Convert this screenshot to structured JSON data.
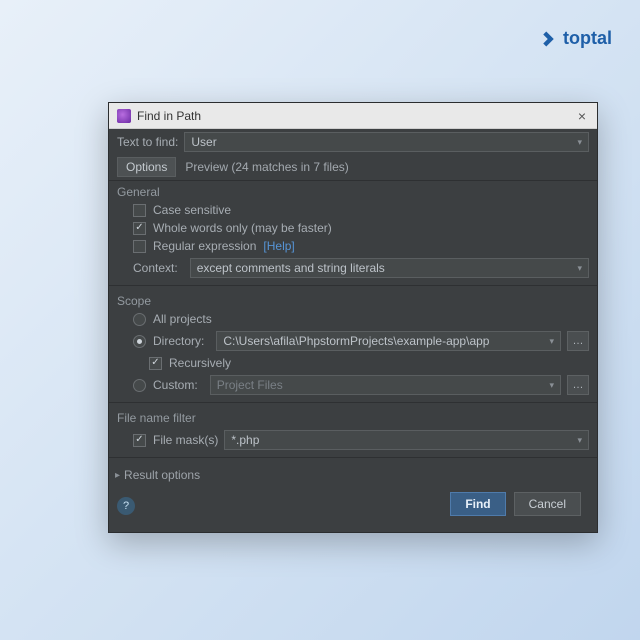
{
  "brand": {
    "name": "toptal"
  },
  "dialog": {
    "title": "Find in Path",
    "text_to_find_label": "Text to find:",
    "text_to_find_value": "User",
    "tabs": {
      "options": "Options",
      "preview": "Preview (24 matches in 7 files)"
    },
    "general": {
      "title": "General",
      "case_sensitive": "Case sensitive",
      "whole_words": "Whole words only (may be faster)",
      "regex": "Regular expression",
      "regex_help": "[Help]",
      "context_label": "Context:",
      "context_value": "except comments and string literals"
    },
    "scope": {
      "title": "Scope",
      "all_projects": "All projects",
      "directory_label": "Directory:",
      "directory_value": "C:\\Users\\afila\\PhpstormProjects\\example-app\\app",
      "recursively": "Recursively",
      "custom_label": "Custom:",
      "custom_value": "Project Files"
    },
    "file_filter": {
      "title": "File name filter",
      "mask_label": "File mask(s)",
      "mask_value": "*.php"
    },
    "result_options": "Result options",
    "buttons": {
      "find": "Find",
      "cancel": "Cancel"
    }
  }
}
